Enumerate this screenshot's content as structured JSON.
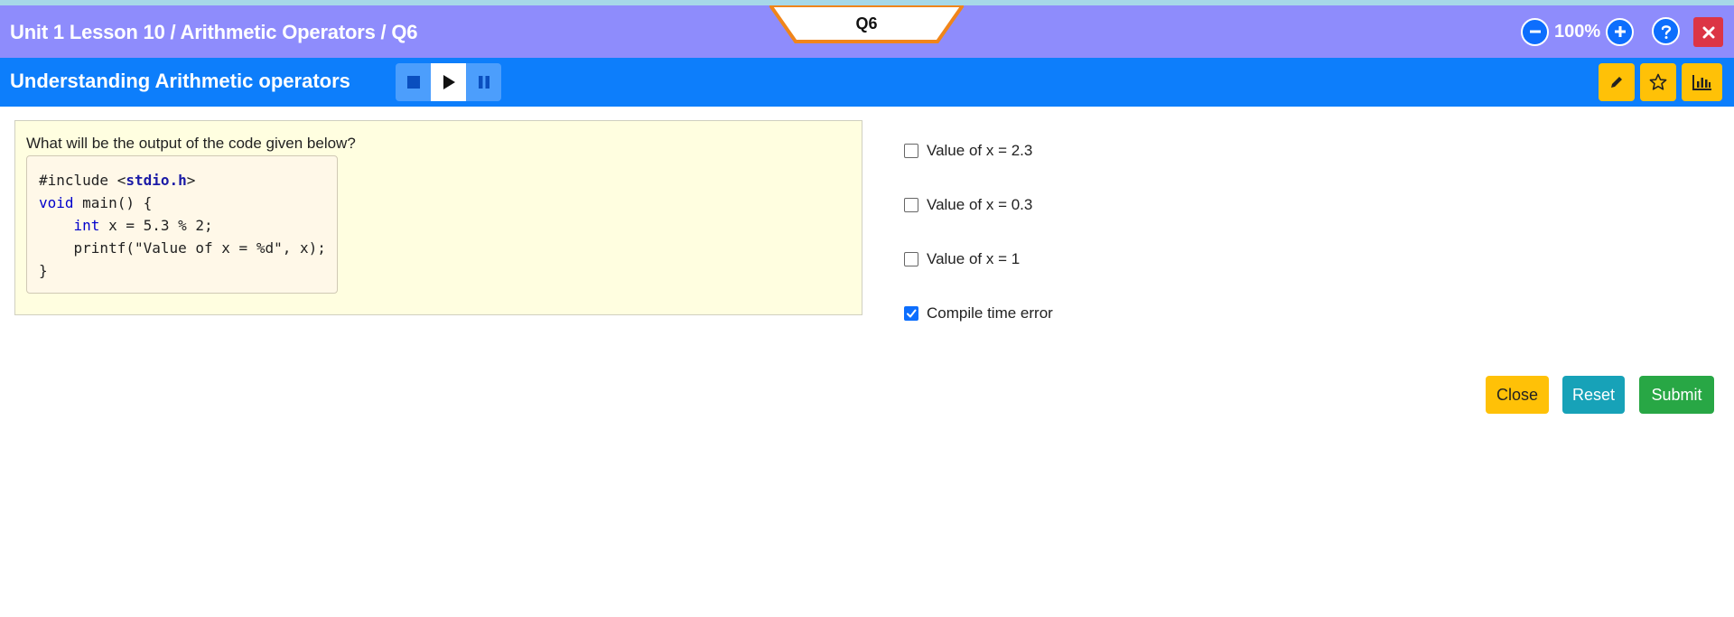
{
  "header": {
    "breadcrumb": "Unit 1 Lesson 10 / Arithmetic Operators / Q6",
    "question_tab": "Q6",
    "zoom": "100%"
  },
  "subheader": {
    "title": "Understanding Arithmetic operators"
  },
  "question": {
    "prompt": "What will be the output of the code given below?",
    "code": {
      "line1_pre": "#include <",
      "line1_hdr": "stdio.h",
      "line1_post": ">",
      "line2_kw": "void",
      "line2_rest": " main() {",
      "line3_indent": "    ",
      "line3_kw": "int",
      "line3_rest": " x = 5.3 % 2;",
      "line4": "    printf(\"Value of x = %d\", x);",
      "line5": "}"
    }
  },
  "options": [
    {
      "label": "Value of x = 2.3",
      "checked": false
    },
    {
      "label": "Value of x = 0.3",
      "checked": false
    },
    {
      "label": "Value of x = 1",
      "checked": false
    },
    {
      "label": "Compile time error",
      "checked": true
    }
  ],
  "actions": {
    "close": "Close",
    "reset": "Reset",
    "submit": "Submit"
  },
  "colors": {
    "header_purple": "#8e8cfc",
    "header_blue": "#0d7efb",
    "accent_orange": "#f0851a",
    "warning": "#ffc107",
    "info": "#17a2b8",
    "success": "#28a745",
    "danger": "#dc3545"
  },
  "icons": {
    "zoom_out": "minus-circle-icon",
    "zoom_in": "plus-circle-icon",
    "help": "question-icon",
    "close": "close-icon",
    "stop": "stop-icon",
    "play": "play-icon",
    "pause": "pause-icon",
    "pencil": "pencil-icon",
    "star": "star-icon",
    "chart": "bar-chart-icon"
  }
}
